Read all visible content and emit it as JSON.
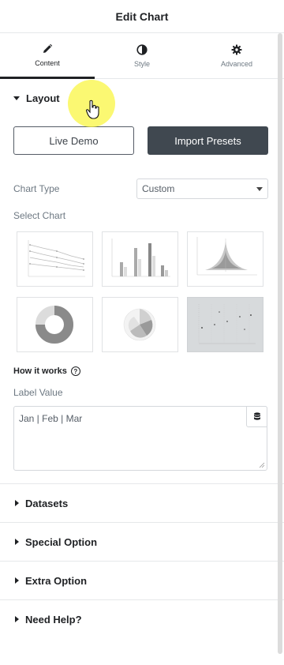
{
  "header": {
    "title": "Edit Chart"
  },
  "tabs": [
    {
      "label": "Content",
      "icon": "pencil-icon",
      "active": true
    },
    {
      "label": "Style",
      "icon": "half-circle-icon",
      "active": false
    },
    {
      "label": "Advanced",
      "icon": "gear-icon",
      "active": false
    }
  ],
  "layout": {
    "title": "Layout",
    "live_demo": "Live Demo",
    "import_presets": "Import Presets",
    "chart_type_label": "Chart Type",
    "chart_type_value": "Custom",
    "select_chart_label": "Select Chart",
    "chart_options": [
      {
        "icon": "line-chart-thumbnail",
        "selected": false
      },
      {
        "icon": "bar-chart-thumbnail",
        "selected": false
      },
      {
        "icon": "radar-chart-thumbnail",
        "selected": false
      },
      {
        "icon": "doughnut-chart-thumbnail",
        "selected": false
      },
      {
        "icon": "polar-area-chart-thumbnail",
        "selected": false
      },
      {
        "icon": "scatter-chart-thumbnail",
        "selected": true
      }
    ],
    "how_it_works": "How it works",
    "label_value_label": "Label Value",
    "label_value": "Jan | Feb | Mar"
  },
  "sections": [
    {
      "title": "Datasets"
    },
    {
      "title": "Special Option"
    },
    {
      "title": "Extra Option"
    },
    {
      "title": "Need Help?"
    }
  ],
  "colors": {
    "accent_dark": "#404850",
    "highlight": "#f8f33c",
    "text": "#1f2124",
    "muted": "#6d7882"
  }
}
